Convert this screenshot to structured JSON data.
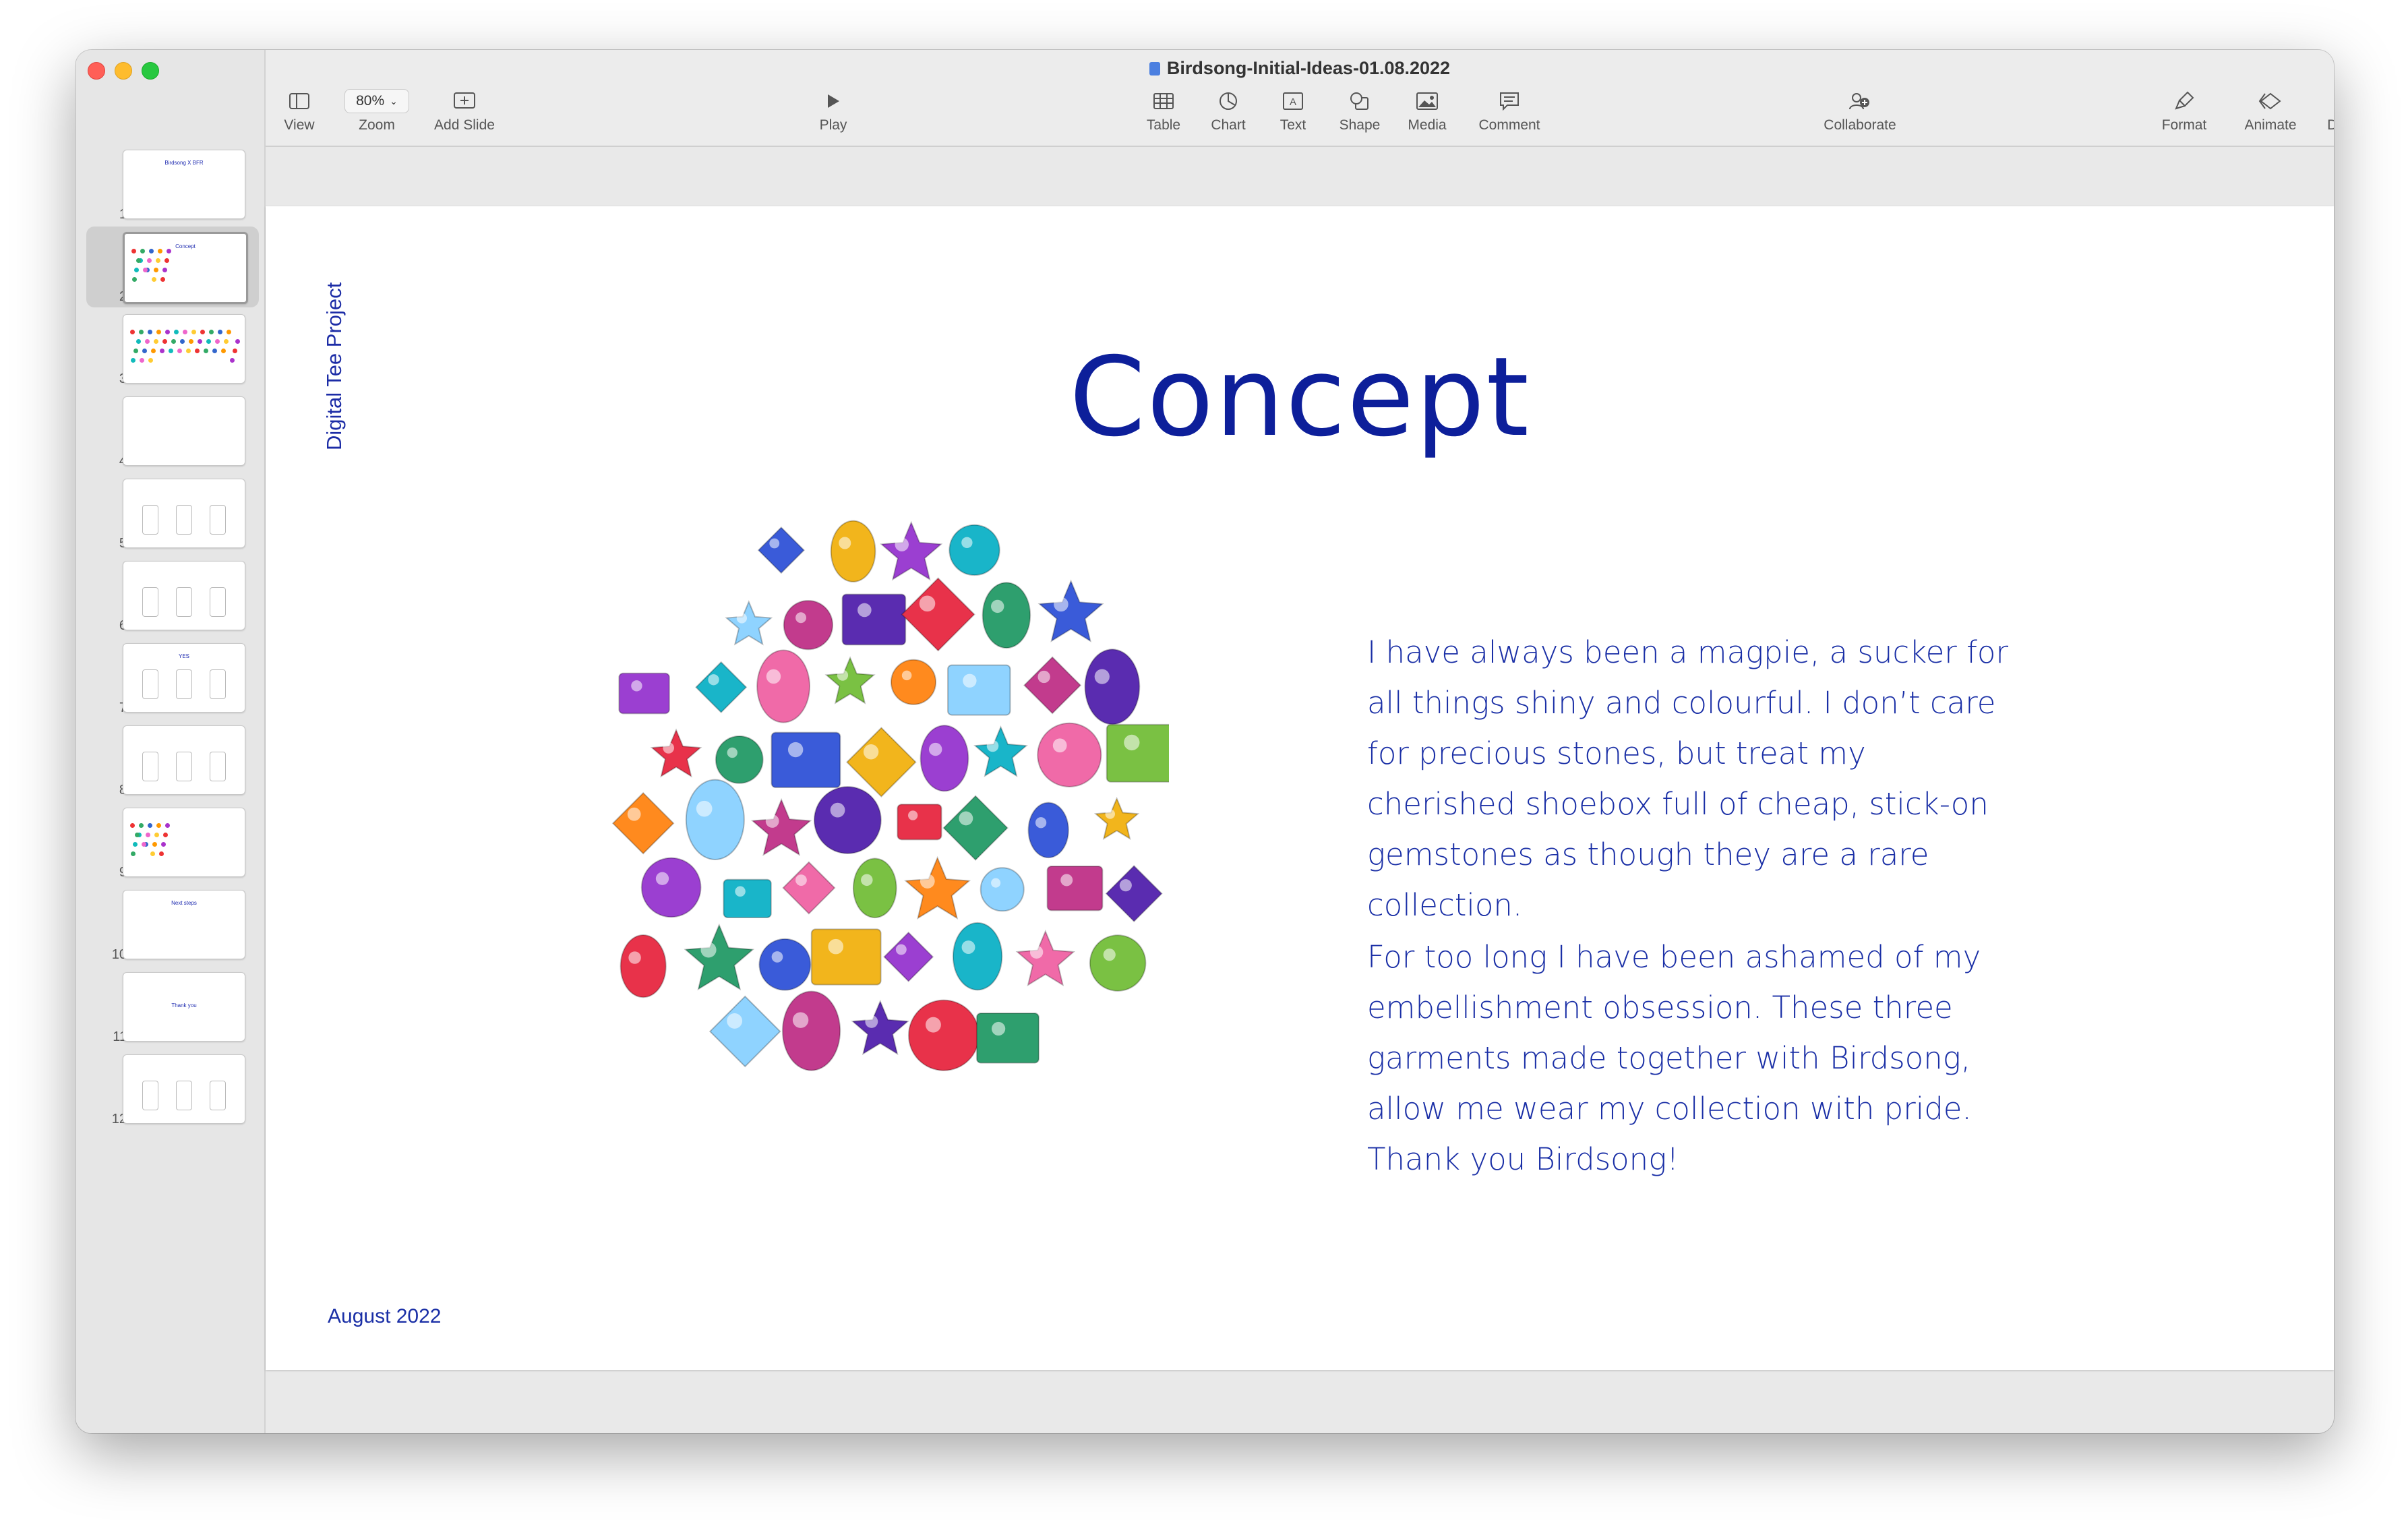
{
  "window": {
    "document_title": "Birdsong-Initial-Ideas-01.08.2022"
  },
  "toolbar": {
    "view_label": "View",
    "zoom_value": "80%",
    "zoom_label": "Zoom",
    "add_slide_label": "Add Slide",
    "play_label": "Play",
    "table_label": "Table",
    "chart_label": "Chart",
    "text_label": "Text",
    "shape_label": "Shape",
    "media_label": "Media",
    "comment_label": "Comment",
    "collaborate_label": "Collaborate",
    "format_label": "Format",
    "animate_label": "Animate",
    "document_label": "Document"
  },
  "navigator": {
    "selected_index": 2,
    "slides": [
      {
        "number": "1",
        "caption": "Birdsong X BFR"
      },
      {
        "number": "2",
        "caption": "Concept"
      },
      {
        "number": "3",
        "caption": ""
      },
      {
        "number": "4",
        "caption": ""
      },
      {
        "number": "5",
        "caption": ""
      },
      {
        "number": "6",
        "caption": ""
      },
      {
        "number": "7",
        "caption": "YES"
      },
      {
        "number": "8",
        "caption": ""
      },
      {
        "number": "9",
        "caption": ""
      },
      {
        "number": "10",
        "caption": "Next steps"
      },
      {
        "number": "11",
        "caption": "Thank you"
      },
      {
        "number": "12",
        "caption": ""
      }
    ]
  },
  "slide": {
    "side_title": "Digital Tee Project",
    "title": "Concept",
    "paragraph_1": "I have always been a magpie, a sucker for all things shiny and colourful. I don’t care for precious stones, but treat my cherished shoebox full of cheap, stick-on gemstones as though they are a rare collection.",
    "paragraph_2": "For too long I have been ashamed of my embellishment obsession. These three garments made together with Birdsong, allow me wear my collection with pride. Thank you Birdsong!",
    "footer_date": "August 2022",
    "image": "gemstones-collage"
  },
  "colors": {
    "slide_text": "#1a2fa6",
    "title_text": "#0d1f9a"
  }
}
